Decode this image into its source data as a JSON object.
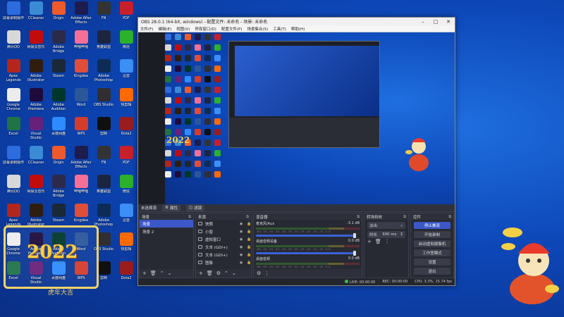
{
  "desktop": {
    "icons": [
      {
        "label": "屏幕录制操作",
        "color": "#2d6cdf"
      },
      {
        "label": "CCleaner",
        "color": "#3a8ad6"
      },
      {
        "label": "Origin",
        "color": "#ef5a2c"
      },
      {
        "label": "Adobe After Effects",
        "color": "#1c1c4f"
      },
      {
        "label": "FN",
        "color": "#333"
      },
      {
        "label": "PDF",
        "color": "#c8202b"
      },
      {
        "label": "腾讯QQ",
        "color": "#d8d8d8"
      },
      {
        "label": "网易云音乐",
        "color": "#c20c0c"
      },
      {
        "label": "Adobe Bridge",
        "color": "#2b2a4a"
      },
      {
        "label": "哔哩哔哩",
        "color": "#f56f97"
      },
      {
        "label": "英雄联盟",
        "color": "#1c2540"
      },
      {
        "label": "微信",
        "color": "#2bb12b"
      },
      {
        "label": "Apex Legends",
        "color": "#b3261e"
      },
      {
        "label": "Adobe Illustrator",
        "color": "#2f1d10"
      },
      {
        "label": "Steam",
        "color": "#1b2838"
      },
      {
        "label": "Kingdee",
        "color": "#e04e39"
      },
      {
        "label": "Adobe Photoshop",
        "color": "#0d2c55"
      },
      {
        "label": "迅雷",
        "color": "#3c8ff4"
      },
      {
        "label": "Google Chrome",
        "color": "#ececec"
      },
      {
        "label": "Adobe Premiere",
        "color": "#1e0b3b"
      },
      {
        "label": "Adobe Audition",
        "color": "#00372b"
      },
      {
        "label": "Word",
        "color": "#2b579a"
      },
      {
        "label": "OBS Studio",
        "color": "#302e31"
      },
      {
        "label": "快剪辑",
        "color": "#ff6a00"
      },
      {
        "label": "Excel",
        "color": "#217346"
      },
      {
        "label": "Visual Studio",
        "color": "#68217a"
      },
      {
        "label": "百度网盘",
        "color": "#2f8cff"
      },
      {
        "label": "WPS",
        "color": "#d43c2c"
      },
      {
        "label": "剪映",
        "color": "#101010"
      },
      {
        "label": "Dota2",
        "color": "#9a1d1d"
      }
    ]
  },
  "deco_left": {
    "year": "2022",
    "caption": "虎年大吉"
  },
  "obs": {
    "title": "OBS 28.0.1 (64-bit, windows) - 配置文件: 未命名 - 场景: 未命名",
    "menu": [
      "文件(F)",
      "编辑(E)",
      "视图(V)",
      "停靠窗口(D)",
      "配置文件(P)",
      "场景集合(S)",
      "工具(T)",
      "帮助(H)"
    ],
    "toolbar": {
      "no_source": "未选择源",
      "properties": "属性",
      "filters": "滤镜"
    },
    "scenes": {
      "title": "场景",
      "items": [
        "场景",
        "场景 2"
      ]
    },
    "sources": {
      "title": "来源",
      "items": [
        "快照",
        "小窗",
        "虚拟窗口",
        "文本 (GDI+)",
        "文本 (GDI+)",
        "图像"
      ]
    },
    "mixer": {
      "title": "混音器",
      "channels": [
        {
          "name": "麦克风/Aux",
          "db": "-3.1 dB"
        },
        {
          "name": "桌面音频设备",
          "db": "0.0 dB"
        },
        {
          "name": "桌面音频",
          "db": "0.0 dB"
        }
      ],
      "scale": "-60 -55 -50 -45 -40 -35 -30 -25 -20 -15 -10 -5 0"
    },
    "transitions": {
      "title": "转场特效",
      "type": "淡出",
      "duration_label": "时长",
      "duration": "300 ms"
    },
    "controls": {
      "title": "控件",
      "buttons": [
        "停止推流",
        "开始录制",
        "启动虚拟摄像机",
        "工作室模式",
        "设置",
        "退出"
      ]
    },
    "status": {
      "live": "LIVE: 00:00:00",
      "rec": "REC: 00:00:00",
      "cpu": "CPU: 3.3%, 15.74 fps"
    }
  }
}
